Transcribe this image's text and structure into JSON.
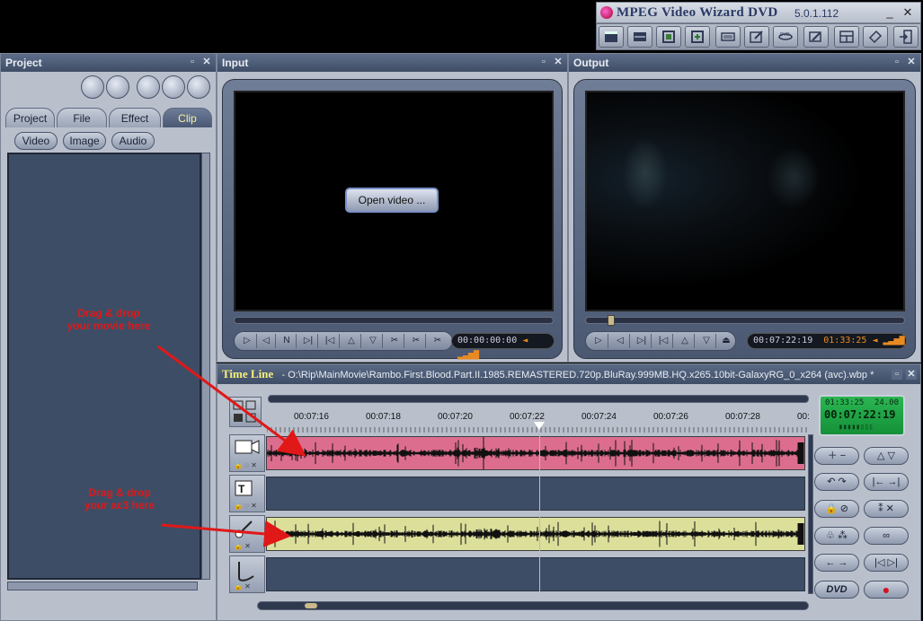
{
  "window": {
    "title": "MPEG Video Wizard DVD",
    "version": "5.0.1.112",
    "minimize": "_",
    "close": "✕"
  },
  "toolbar": {
    "icons": [
      "clapper-icon",
      "timeline-icon",
      "capture-icon",
      "export-icon",
      "keyboard-icon",
      "edit-icon",
      "dvd-icon",
      "tools-icon",
      "layout-icon",
      "tag-icon",
      "exit-icon"
    ]
  },
  "project_panel": {
    "title": "Project",
    "tabs": [
      "Project",
      "File",
      "Effect",
      "Clip"
    ],
    "active_tab": "Clip",
    "filters": [
      "Video",
      "Image",
      "Audio"
    ]
  },
  "input_panel": {
    "title": "Input",
    "open_button": "Open video ...",
    "timecode": "00:00:00:00"
  },
  "output_panel": {
    "title": "Output",
    "timecode": "00:07:22:19",
    "duration": "01:33:25"
  },
  "timeline": {
    "title": "Time Line",
    "file_path": "- O:\\Rip\\MainMovie\\Rambo.First.Blood.Part.II.1985.REMASTERED.720p.BluRay.999MB.HQ.x265.10bit-GalaxyRG_0_x264 (avc).wbp *",
    "ruler_labels": [
      "00:07:16",
      "00:07:18",
      "00:07:20",
      "00:07:22",
      "00:07:24",
      "00:07:26",
      "00:07:28",
      "00:"
    ],
    "display": {
      "duration": "01:33:25",
      "fps": "24.00",
      "current": "00:07:22:19"
    },
    "dvd_label": "DVD",
    "playhead": 0.507
  },
  "annotations": {
    "movie": "Drag & drop\nyour movie here",
    "audio": "Drag & drop\nyour ac3 here"
  },
  "colors": {
    "video_track": "#dc6d8e",
    "audio_track": "#dcdf9a",
    "annotation": "#e01818",
    "timecode_green": "#21b34a"
  }
}
